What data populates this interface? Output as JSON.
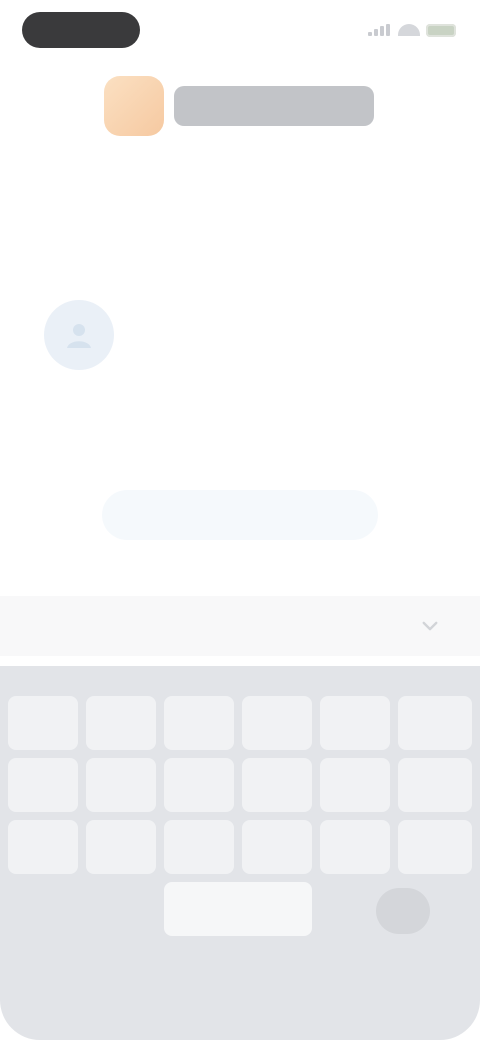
{
  "onboarding": {
    "title": "",
    "subtitle_line_1": "",
    "subtitle_line_2": "",
    "account_text": "",
    "link_text": "",
    "primary_button_label": ""
  },
  "keyboard": {
    "rows": [
      [
        "",
        "",
        "",
        "",
        "",
        ""
      ],
      [
        "",
        "",
        "",
        "",
        "",
        ""
      ],
      [
        "",
        "",
        "",
        "",
        "",
        ""
      ]
    ],
    "space_label": "",
    "return_label": ""
  },
  "icons": {
    "status_signal": "signal-icon",
    "status_wifi": "wifi-icon",
    "status_battery": "battery-icon",
    "account": "user-icon",
    "accessory": "chevron-down-icon"
  },
  "colors": {
    "brand_mark": "#f6c9a1",
    "primary_button_bg": "#f5f9fc",
    "link": "#b7d6de",
    "keyboard_bg": "#e2e4e8"
  }
}
